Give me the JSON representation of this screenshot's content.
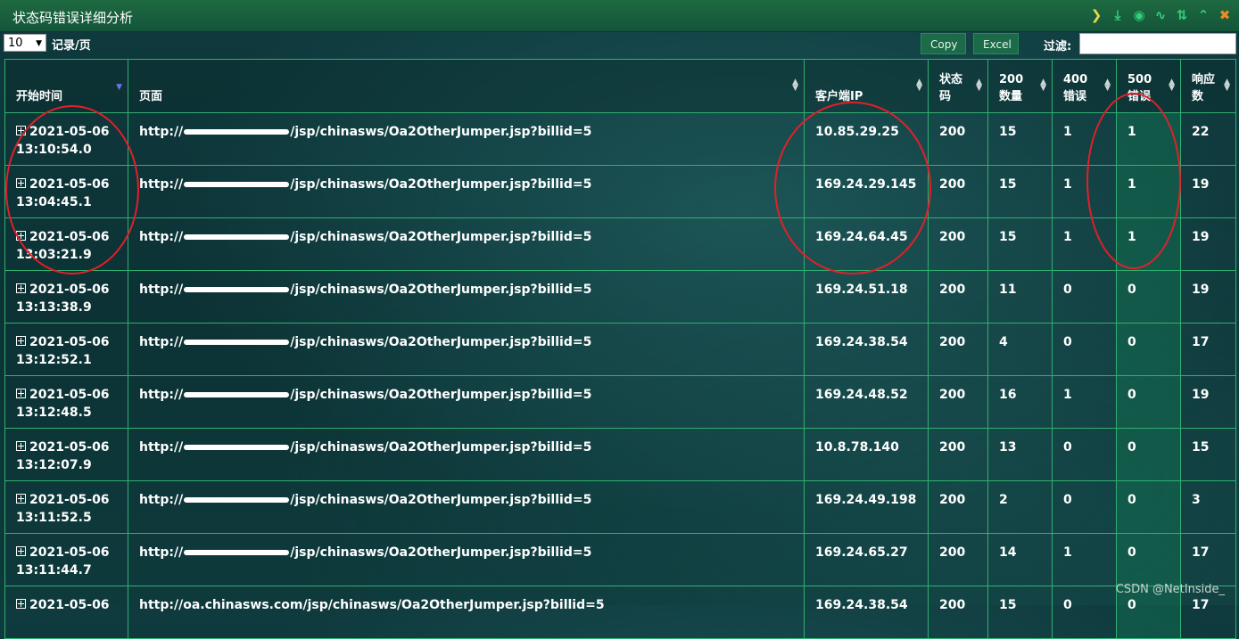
{
  "window": {
    "title": "状态码错误详细分析"
  },
  "toolbar_icons": [
    {
      "name": "next-icon",
      "glyph": "❯",
      "color": "yellow"
    },
    {
      "name": "download-icon",
      "glyph": "⤓",
      "color": "green"
    },
    {
      "name": "chrome-icon",
      "glyph": "◉",
      "color": "green"
    },
    {
      "name": "line-chart-icon",
      "glyph": "∿",
      "color": "green"
    },
    {
      "name": "sort-icon",
      "glyph": "⇅",
      "color": "green"
    },
    {
      "name": "collapse-icon",
      "glyph": "⌃",
      "color": "green"
    },
    {
      "name": "close-icon",
      "glyph": "✖",
      "color": "orange"
    }
  ],
  "controls": {
    "page_size": "10",
    "per_page_label": "记录/页",
    "copy_label": "Copy",
    "excel_label": "Excel",
    "filter_label": "过滤:",
    "filter_value": ""
  },
  "table": {
    "columns": [
      {
        "key": "start",
        "label": "开始时间"
      },
      {
        "key": "page",
        "label": "页面"
      },
      {
        "key": "ip",
        "label": "客户端IP"
      },
      {
        "key": "status",
        "label": "状态码"
      },
      {
        "key": "c200",
        "label": "200数量"
      },
      {
        "key": "e400",
        "label": "400错误"
      },
      {
        "key": "e500",
        "label": "500错误"
      },
      {
        "key": "resp",
        "label": "响应数"
      }
    ],
    "rows": [
      {
        "date": "2021-05-06",
        "time": "13:10:54.0",
        "url_prefix": "http://",
        "url_suffix": "/jsp/chinasws/Oa2OtherJumper.jsp?billid=5",
        "ip": "10.85.29.25",
        "status": "200",
        "c200": "15",
        "e400": "1",
        "e500": "1",
        "resp": "22"
      },
      {
        "date": "2021-05-06",
        "time": "13:04:45.1",
        "url_prefix": "http://",
        "url_suffix": "/jsp/chinasws/Oa2OtherJumper.jsp?billid=5",
        "ip": "169.24.29.145",
        "status": "200",
        "c200": "15",
        "e400": "1",
        "e500": "1",
        "resp": "19"
      },
      {
        "date": "2021-05-06",
        "time": "13:03:21.9",
        "url_prefix": "http://",
        "url_suffix": "/jsp/chinasws/Oa2OtherJumper.jsp?billid=5",
        "ip": "169.24.64.45",
        "status": "200",
        "c200": "15",
        "e400": "1",
        "e500": "1",
        "resp": "19"
      },
      {
        "date": "2021-05-06",
        "time": "13:13:38.9",
        "url_prefix": "http://",
        "url_suffix": "/jsp/chinasws/Oa2OtherJumper.jsp?billid=5",
        "ip": "169.24.51.18",
        "status": "200",
        "c200": "11",
        "e400": "0",
        "e500": "0",
        "resp": "19"
      },
      {
        "date": "2021-05-06",
        "time": "13:12:52.1",
        "url_prefix": "http://",
        "url_suffix": "/jsp/chinasws/Oa2OtherJumper.jsp?billid=5",
        "ip": "169.24.38.54",
        "status": "200",
        "c200": "4",
        "e400": "0",
        "e500": "0",
        "resp": "17"
      },
      {
        "date": "2021-05-06",
        "time": "13:12:48.5",
        "url_prefix": "http://",
        "url_suffix": "/jsp/chinasws/Oa2OtherJumper.jsp?billid=5",
        "ip": "169.24.48.52",
        "status": "200",
        "c200": "16",
        "e400": "1",
        "e500": "0",
        "resp": "19"
      },
      {
        "date": "2021-05-06",
        "time": "13:12:07.9",
        "url_prefix": "http://",
        "url_suffix": "/jsp/chinasws/Oa2OtherJumper.jsp?billid=5",
        "ip": "10.8.78.140",
        "status": "200",
        "c200": "13",
        "e400": "0",
        "e500": "0",
        "resp": "15"
      },
      {
        "date": "2021-05-06",
        "time": "13:11:52.5",
        "url_prefix": "http://",
        "url_suffix": "/jsp/chinasws/Oa2OtherJumper.jsp?billid=5",
        "ip": "169.24.49.198",
        "status": "200",
        "c200": "2",
        "e400": "0",
        "e500": "0",
        "resp": "3"
      },
      {
        "date": "2021-05-06",
        "time": "13:11:44.7",
        "url_prefix": "http://",
        "url_suffix": "/jsp/chinasws/Oa2OtherJumper.jsp?billid=5",
        "ip": "169.24.65.27",
        "status": "200",
        "c200": "14",
        "e400": "1",
        "e500": "0",
        "resp": "17"
      },
      {
        "date": "2021-05-06",
        "time": "",
        "url_prefix": "http://oa.chinasws.com",
        "url_suffix": "/jsp/chinasws/Oa2OtherJumper.jsp?billid=5",
        "ip": "169.24.38.54",
        "status": "200",
        "c200": "15",
        "e400": "0",
        "e500": "0",
        "resp": "17"
      }
    ]
  },
  "annotation_color": "#e0202a",
  "watermark": "CSDN @NetInside_"
}
